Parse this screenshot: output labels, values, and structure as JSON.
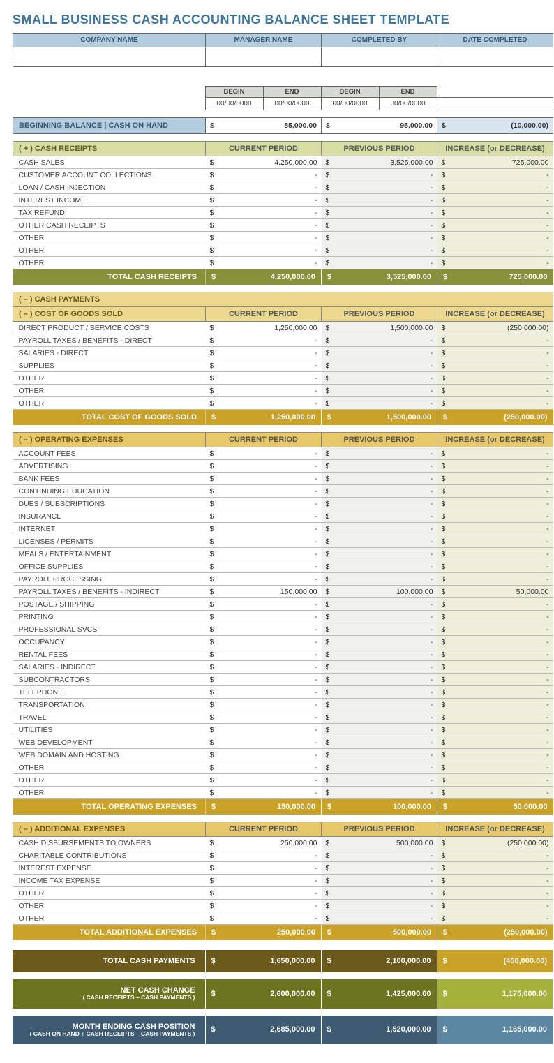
{
  "title": "SMALL BUSINESS CASH ACCOUNTING BALANCE SHEET TEMPLATE",
  "header": {
    "company_label": "COMPANY NAME",
    "manager_label": "MANAGER NAME",
    "completed_by_label": "COMPLETED BY",
    "date_completed_label": "DATE COMPLETED",
    "company": "",
    "manager": "",
    "completed_by": "",
    "date_completed": ""
  },
  "period": {
    "current_label": "CURRENT PERIOD",
    "previous_label": "PREVIOUS PERIOD",
    "begin_label": "BEGIN",
    "end_label": "END",
    "placeholder": "00/00/0000",
    "incdec_label": "INCREASE (or DECREASE)"
  },
  "beginning_balance": {
    "label": "BEGINNING BALANCE  |  CASH ON HAND",
    "current": "85,000.00",
    "previous": "95,000.00",
    "diff": "(10,000.00)"
  },
  "dollar": "$",
  "dash": "-",
  "colhdr": {
    "current": "CURRENT PERIOD",
    "previous": "PREVIOUS PERIOD",
    "incdec": "INCREASE (or DECREASE)"
  },
  "receipts": {
    "title": "( + )  CASH RECEIPTS",
    "rows": [
      {
        "label": "CASH SALES",
        "c": "4,250,000.00",
        "p": "3,525,000.00",
        "d": "725,000.00"
      },
      {
        "label": "CUSTOMER ACCOUNT COLLECTIONS",
        "c": "-",
        "p": "-",
        "d": "-"
      },
      {
        "label": "LOAN / CASH INJECTION",
        "c": "-",
        "p": "-",
        "d": "-"
      },
      {
        "label": "INTEREST INCOME",
        "c": "-",
        "p": "-",
        "d": "-"
      },
      {
        "label": "TAX REFUND",
        "c": "-",
        "p": "-",
        "d": "-"
      },
      {
        "label": "OTHER CASH RECEIPTS",
        "c": "-",
        "p": "-",
        "d": "-"
      },
      {
        "label": "OTHER",
        "c": "-",
        "p": "-",
        "d": "-"
      },
      {
        "label": "OTHER",
        "c": "-",
        "p": "-",
        "d": "-"
      },
      {
        "label": "OTHER",
        "c": "-",
        "p": "-",
        "d": "-"
      }
    ],
    "total_label": "TOTAL CASH RECEIPTS",
    "total": {
      "c": "4,250,000.00",
      "p": "3,525,000.00",
      "d": "725,000.00"
    }
  },
  "cash_payments_title": "( – )  CASH PAYMENTS",
  "cogs": {
    "title": "( – )  COST OF GOODS SOLD",
    "rows": [
      {
        "label": "DIRECT PRODUCT / SERVICE COSTS",
        "c": "1,250,000.00",
        "p": "1,500,000.00",
        "d": "(250,000.00)"
      },
      {
        "label": "PAYROLL TAXES / BENEFITS - DIRECT",
        "c": "-",
        "p": "-",
        "d": "-"
      },
      {
        "label": "SALARIES - DIRECT",
        "c": "-",
        "p": "-",
        "d": "-"
      },
      {
        "label": "SUPPLIES",
        "c": "-",
        "p": "-",
        "d": "-"
      },
      {
        "label": "OTHER",
        "c": "-",
        "p": "-",
        "d": "-"
      },
      {
        "label": "OTHER",
        "c": "-",
        "p": "-",
        "d": "-"
      },
      {
        "label": "OTHER",
        "c": "-",
        "p": "-",
        "d": "-"
      }
    ],
    "total_label": "TOTAL COST OF GOODS SOLD",
    "total": {
      "c": "1,250,000.00",
      "p": "1,500,000.00",
      "d": "(250,000.00)"
    }
  },
  "opex": {
    "title": "( – )  OPERATING EXPENSES",
    "rows": [
      {
        "label": "ACCOUNT FEES",
        "c": "-",
        "p": "-",
        "d": "-"
      },
      {
        "label": "ADVERTISING",
        "c": "-",
        "p": "-",
        "d": "-"
      },
      {
        "label": "BANK FEES",
        "c": "-",
        "p": "-",
        "d": "-"
      },
      {
        "label": "CONTINUING EDUCATION",
        "c": "-",
        "p": "-",
        "d": "-"
      },
      {
        "label": "DUES / SUBSCRIPTIONS",
        "c": "-",
        "p": "-",
        "d": "-"
      },
      {
        "label": "INSURANCE",
        "c": "-",
        "p": "-",
        "d": "-"
      },
      {
        "label": "INTERNET",
        "c": "-",
        "p": "-",
        "d": "-"
      },
      {
        "label": "LICENSES / PERMITS",
        "c": "-",
        "p": "-",
        "d": "-"
      },
      {
        "label": "MEALS / ENTERTAINMENT",
        "c": "-",
        "p": "-",
        "d": "-"
      },
      {
        "label": "OFFICE SUPPLIES",
        "c": "-",
        "p": "-",
        "d": "-"
      },
      {
        "label": "PAYROLL PROCESSING",
        "c": "-",
        "p": "-",
        "d": "-"
      },
      {
        "label": "PAYROLL TAXES / BENEFITS - INDIRECT",
        "c": "150,000.00",
        "p": "100,000.00",
        "d": "50,000.00"
      },
      {
        "label": "POSTAGE / SHIPPING",
        "c": "-",
        "p": "-",
        "d": "-"
      },
      {
        "label": "PRINTING",
        "c": "-",
        "p": "-",
        "d": "-"
      },
      {
        "label": "PROFESSIONAL SVCS",
        "c": "-",
        "p": "-",
        "d": "-"
      },
      {
        "label": "OCCUPANCY",
        "c": "-",
        "p": "-",
        "d": "-"
      },
      {
        "label": "RENTAL FEES",
        "c": "-",
        "p": "-",
        "d": "-"
      },
      {
        "label": "SALARIES - INDIRECT",
        "c": "-",
        "p": "-",
        "d": "-"
      },
      {
        "label": "SUBCONTRACTORS",
        "c": "-",
        "p": "-",
        "d": "-"
      },
      {
        "label": "TELEPHONE",
        "c": "-",
        "p": "-",
        "d": "-"
      },
      {
        "label": "TRANSPORTATION",
        "c": "-",
        "p": "-",
        "d": "-"
      },
      {
        "label": "TRAVEL",
        "c": "-",
        "p": "-",
        "d": "-"
      },
      {
        "label": "UTILITIES",
        "c": "-",
        "p": "-",
        "d": "-"
      },
      {
        "label": "WEB DEVELOPMENT",
        "c": "-",
        "p": "-",
        "d": "-"
      },
      {
        "label": "WEB DOMAIN AND HOSTING",
        "c": "-",
        "p": "-",
        "d": "-"
      },
      {
        "label": "OTHER",
        "c": "-",
        "p": "-",
        "d": "-"
      },
      {
        "label": "OTHER",
        "c": "-",
        "p": "-",
        "d": "-"
      },
      {
        "label": "OTHER",
        "c": "-",
        "p": "-",
        "d": "-"
      }
    ],
    "total_label": "TOTAL OPERATING EXPENSES",
    "total": {
      "c": "150,000.00",
      "p": "100,000.00",
      "d": "50,000.00"
    }
  },
  "addl": {
    "title": "( – )  ADDITIONAL EXPENSES",
    "rows": [
      {
        "label": "CASH DISBURSEMENTS TO OWNERS",
        "c": "250,000.00",
        "p": "500,000.00",
        "d": "(250,000.00)"
      },
      {
        "label": "CHARITABLE CONTRIBUTIONS",
        "c": "-",
        "p": "-",
        "d": "-"
      },
      {
        "label": "INTEREST EXPENSE",
        "c": "-",
        "p": "-",
        "d": "-"
      },
      {
        "label": "INCOME TAX EXPENSE",
        "c": "-",
        "p": "-",
        "d": "-"
      },
      {
        "label": "OTHER",
        "c": "-",
        "p": "-",
        "d": "-"
      },
      {
        "label": "OTHER",
        "c": "-",
        "p": "-",
        "d": "-"
      },
      {
        "label": "OTHER",
        "c": "-",
        "p": "-",
        "d": "-"
      }
    ],
    "total_label": "TOTAL ADDITIONAL EXPENSES",
    "total": {
      "c": "250,000.00",
      "p": "500,000.00",
      "d": "(250,000.00)"
    }
  },
  "summary": {
    "tcp": {
      "label": "TOTAL CASH PAYMENTS",
      "c": "1,650,000.00",
      "p": "2,100,000.00",
      "d": "(450,000.00)"
    },
    "ncc": {
      "label": "NET CASH CHANGE",
      "sub": "( CASH RECEIPTS – CASH PAYMENTS )",
      "c": "2,600,000.00",
      "p": "1,425,000.00",
      "d": "1,175,000.00"
    },
    "mecp": {
      "label": "MONTH ENDING CASH POSITION",
      "sub": "( CASH ON HAND + CASH RECEIPTS – CASH PAYMENTS )",
      "c": "2,685,000.00",
      "p": "1,520,000.00",
      "d": "1,165,000.00"
    }
  }
}
